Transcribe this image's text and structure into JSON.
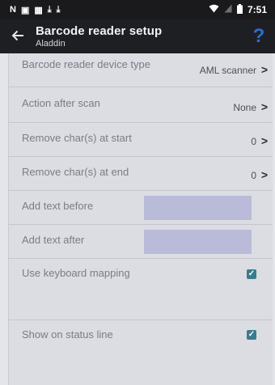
{
  "status_bar": {
    "icons": [
      "N",
      "▣",
      "▦",
      "⤓",
      "⤓"
    ],
    "time": "7:51"
  },
  "app_bar": {
    "title": "Barcode reader setup",
    "subtitle": "Aladdin",
    "help_glyph": "?"
  },
  "settings": {
    "device_type": {
      "label": "Barcode reader device type",
      "value": "AML scanner"
    },
    "action_after_scan": {
      "label": "Action after scan",
      "value": "None"
    },
    "remove_start": {
      "label": "Remove char(s) at start",
      "value": "0"
    },
    "remove_end": {
      "label": "Remove char(s) at end",
      "value": "0"
    },
    "add_before": {
      "label": "Add text before",
      "value": ""
    },
    "add_after": {
      "label": "Add text after",
      "value": ""
    },
    "keyboard_mapping": {
      "label": "Use keyboard mapping",
      "checked": true
    },
    "status_line": {
      "label": "Show on status line",
      "checked": true
    }
  },
  "colors": {
    "accent": "#2e6bd6",
    "checkbox": "#3a7c8d",
    "textbox": "#b9bbd9"
  }
}
